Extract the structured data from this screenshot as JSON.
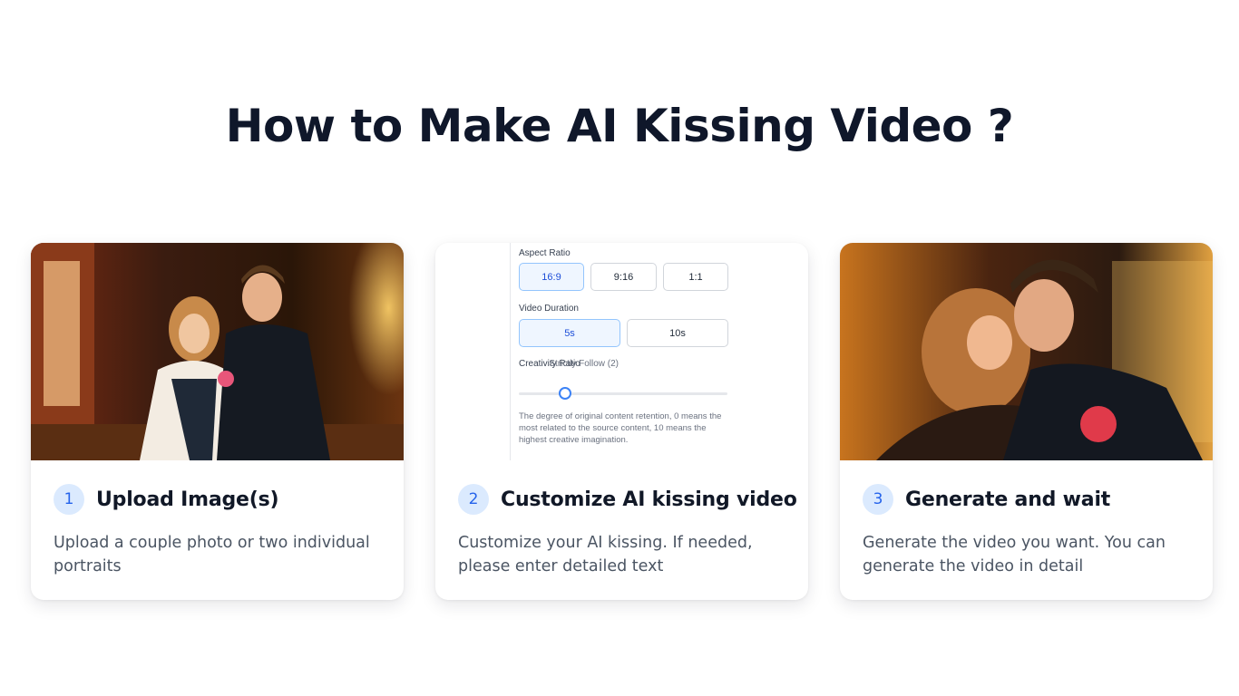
{
  "page": {
    "title": "How to Make AI Kissing Video ?"
  },
  "steps": [
    {
      "number": "1",
      "title": "Upload Image(s)",
      "description": "Upload a couple photo or two individual portraits"
    },
    {
      "number": "2",
      "title": "Customize AI kissing video",
      "description": "Customize your AI kissing. If needed, please enter detailed text"
    },
    {
      "number": "3",
      "title": "Generate and wait",
      "description": "Generate the video you want. You can generate the video in detail"
    }
  ],
  "settings_panel": {
    "aspect_ratio_label": "Aspect Ratio",
    "aspect_options": [
      "16:9",
      "9:16",
      "1:1"
    ],
    "aspect_selected": "16:9",
    "duration_label": "Video Duration",
    "duration_options": [
      "5s",
      "10s"
    ],
    "duration_selected": "5s",
    "creativity_label": "Creativity Ratio",
    "creativity_value_label": "Strictly Follow (2)",
    "creativity_value": 2,
    "creativity_range": [
      0,
      10
    ],
    "creativity_hint": "The degree of original content retention, 0 means the most related to the source content, 10 means the highest creative imagination."
  },
  "colors": {
    "accent": "#2563eb",
    "badge_bg": "#dbeafe",
    "heading": "#0f172a",
    "body_text": "#4b5563"
  }
}
